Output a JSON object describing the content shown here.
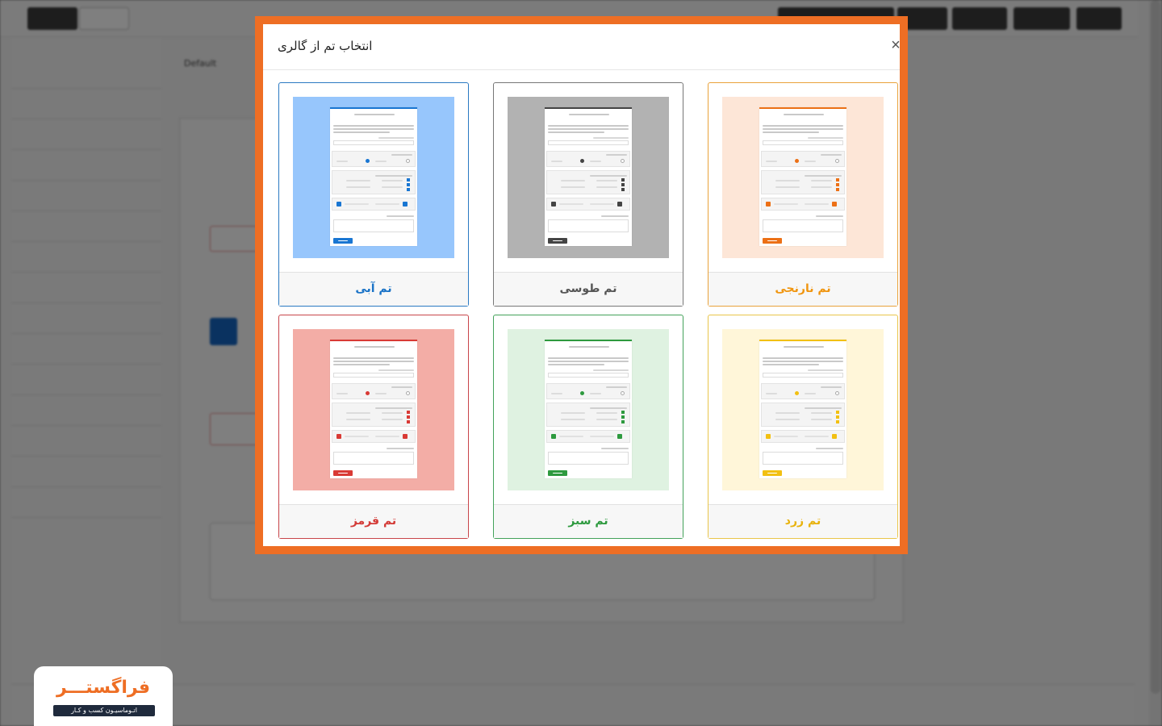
{
  "modal": {
    "title": "انتخاب تم از گالری",
    "close_label": "×",
    "themes": [
      {
        "label": "تم نارنجی",
        "accent": "#ec7016",
        "text_color": "#f0950f",
        "bg": "#fde6d7",
        "border": "#e9a23b"
      },
      {
        "label": "تم طوسی",
        "accent": "#444444",
        "text_color": "#555555",
        "bg": "#b2b2b2",
        "border": "#777777"
      },
      {
        "label": "تم آبی",
        "accent": "#1976d2",
        "text_color": "#1a73c7",
        "bg": "#97c6fc",
        "border": "#2a79c2"
      },
      {
        "label": "تم زرد",
        "accent": "#f2c012",
        "text_color": "#e8b20c",
        "bg": "#fff6d9",
        "border": "#e9c54a"
      },
      {
        "label": "تم سبز",
        "accent": "#2e9a3f",
        "text_color": "#2e9a3f",
        "bg": "#dff2e1",
        "border": "#43a25a"
      },
      {
        "label": "تم قرمز",
        "accent": "#d93a35",
        "text_color": "#d33b37",
        "bg": "#f3ada6",
        "border": "#c8454a"
      }
    ]
  },
  "logo": {
    "main": "فراگستـــر",
    "sub": "اتـوماسیـون کسب و کـار",
    "color": "#ee6e24"
  },
  "background": {
    "select_value": "Default"
  }
}
